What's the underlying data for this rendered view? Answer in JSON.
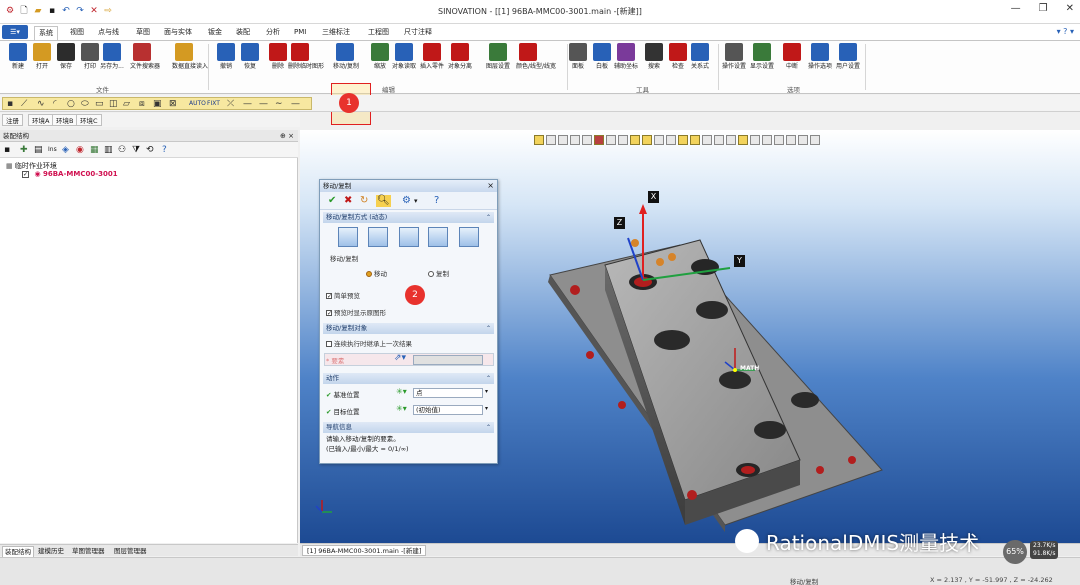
{
  "window": {
    "title": "SINOVATION - [[1] 96BA-MMC00-3001.main -[新建]]",
    "controls": [
      "—",
      "❐",
      "✕"
    ]
  },
  "ribbon_tabs": {
    "file_btn": "☰▾",
    "items": [
      "系统",
      "视图",
      "点与线",
      "草图",
      "面与实体",
      "钣金",
      "装配",
      "分析",
      "PMI",
      "三维标注",
      "工程图",
      "尺寸注释"
    ],
    "active": "系统",
    "help_label": "▾ ? ▾"
  },
  "ribbon": {
    "buttons": [
      {
        "label": "新建",
        "icon": "new-file-icon"
      },
      {
        "label": "打开",
        "icon": "open-folder-icon"
      },
      {
        "label": "保存",
        "icon": "save-icon"
      },
      {
        "label": "打印",
        "icon": "print-icon"
      },
      {
        "label": "另存为...",
        "icon": "save-as-icon"
      },
      {
        "label": "文件搜索器",
        "icon": "file-search-icon"
      },
      {
        "label": "数据直接读入",
        "icon": "data-import-icon"
      },
      {
        "label": "撤销",
        "icon": "undo-icon"
      },
      {
        "label": "恢复",
        "icon": "redo-icon"
      },
      {
        "label": "删除",
        "icon": "delete-icon"
      },
      {
        "label": "删除临时图形",
        "icon": "delete-temp-icon"
      },
      {
        "label": "移动/复制",
        "icon": "move-copy-icon"
      },
      {
        "label": "缩放",
        "icon": "scale-icon"
      },
      {
        "label": "对象读取",
        "icon": "object-read-icon"
      },
      {
        "label": "插入零件",
        "icon": "insert-part-icon"
      },
      {
        "label": "对象分离",
        "icon": "object-split-icon"
      },
      {
        "label": "图层设置",
        "icon": "layer-icon"
      },
      {
        "label": "颜色/线型/线宽",
        "icon": "color-line-icon"
      },
      {
        "label": "面板",
        "icon": "panel-icon"
      },
      {
        "label": "白板",
        "icon": "whiteboard-icon"
      },
      {
        "label": "辅助坐标",
        "icon": "aux-coord-icon"
      },
      {
        "label": "搜索",
        "icon": "search-binoculars-icon"
      },
      {
        "label": "检查",
        "icon": "check-icon"
      },
      {
        "label": "关系式",
        "icon": "relation-icon"
      },
      {
        "label": "操作设置",
        "icon": "op-settings-icon"
      },
      {
        "label": "显示设置",
        "icon": "display-settings-icon"
      },
      {
        "label": "中断",
        "icon": "stop-icon"
      },
      {
        "label": "操作选项",
        "icon": "op-options-icon"
      },
      {
        "label": "用户设置",
        "icon": "user-settings-icon"
      }
    ],
    "groups": [
      "文件",
      "编辑",
      "工具",
      "选项"
    ]
  },
  "toolbar2": {
    "auto": "AUTO",
    "fixed": "FIXT"
  },
  "env_tabs": [
    "注册",
    "环境A",
    "环境B",
    "环境C"
  ],
  "left_panel": {
    "title": "装配结构",
    "pin": "⊕ ×",
    "tree_root": "临时作业环境",
    "tree_child": "96BA-MMC00-3001",
    "bottom_tabs": [
      "装配结构",
      "建模历史",
      "草图管理器",
      "图层管理器"
    ]
  },
  "viewport": {
    "doc_tab": "[1] 96BA-MMC00-3001.main -[新建]",
    "axis_x": "X",
    "axis_y": "Y",
    "axis_z": "Z",
    "math_label": "MATH"
  },
  "dialog": {
    "title": "移动/复制",
    "section_mode": "移动/复制方式 (动态)",
    "group_copy": "移动/复制",
    "radio_move": "移动",
    "radio_copy": "复制",
    "chk_simple": "简单预览",
    "chk_preview": "预览时显示原图形",
    "section_objects": "移动/复制对象",
    "chk_continuous": "连续执行时继承上一次结果",
    "required_label": "* 要素",
    "section_action": "动作",
    "base_pos": "基准位置",
    "base_val": "点",
    "target_pos": "目标位置",
    "target_val": "(初始值)",
    "section_nav": "导航信息",
    "nav_line1": "请输入移动/复制的要素。",
    "nav_line2": "(已输入/最小/最大 = 0/1/∞)"
  },
  "annotations": {
    "callout1": "1",
    "callout2": "2"
  },
  "status": {
    "mid": "移动/复制",
    "coords": "X = 2.137 , Y = -51.997 , Z = -24.262",
    "perf_pct": "65%",
    "perf_up": "23.7K/s",
    "perf_down": "91.8K/s"
  },
  "watermark": "RationalDMIS测量技术"
}
